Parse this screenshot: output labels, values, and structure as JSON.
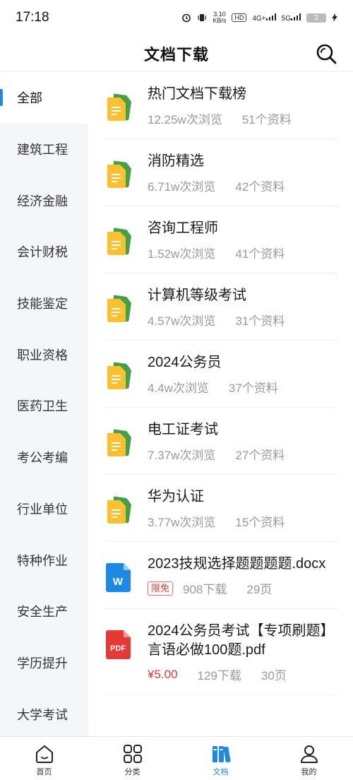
{
  "status_bar": {
    "time": "17:18",
    "net_speed_value": "3.10",
    "net_speed_unit": "KB/s",
    "hd_label": "HD",
    "signal_4g": "4G+",
    "signal_5g": "5G",
    "battery": "2"
  },
  "header": {
    "title": "文档下载"
  },
  "sidebar": {
    "items": [
      {
        "label": "全部",
        "active": true
      },
      {
        "label": "建筑工程"
      },
      {
        "label": "经济金融"
      },
      {
        "label": "会计财税"
      },
      {
        "label": "技能鉴定"
      },
      {
        "label": "职业资格"
      },
      {
        "label": "医药卫生"
      },
      {
        "label": "考公考编"
      },
      {
        "label": "行业单位"
      },
      {
        "label": "特种作业"
      },
      {
        "label": "安全生产"
      },
      {
        "label": "学历提升"
      },
      {
        "label": "大学考试"
      }
    ]
  },
  "list": {
    "items": [
      {
        "icon": "folder-doc-icon",
        "title": "热门文档下载榜",
        "views": "12.25w次浏览",
        "count": "51个资料"
      },
      {
        "icon": "folder-doc-icon",
        "title": "消防精选",
        "views": "6.71w次浏览",
        "count": "42个资料"
      },
      {
        "icon": "folder-doc-icon",
        "title": "咨询工程师",
        "views": "1.52w次浏览",
        "count": "41个资料"
      },
      {
        "icon": "folder-doc-icon",
        "title": "计算机等级考试",
        "views": "4.57w次浏览",
        "count": "31个资料"
      },
      {
        "icon": "folder-doc-icon",
        "title": "2024公务员",
        "views": "4.4w次浏览",
        "count": "37个资料"
      },
      {
        "icon": "folder-doc-icon",
        "title": "电工证考试",
        "views": "7.37w次浏览",
        "count": "27个资料"
      },
      {
        "icon": "folder-doc-icon",
        "title": "华为认证",
        "views": "3.77w次浏览",
        "count": "15个资料"
      },
      {
        "icon": "word-file-icon",
        "title": "2023技规选择题题题题.docx",
        "tag": "限免",
        "views": "908下载",
        "count": "29页"
      },
      {
        "icon": "pdf-file-icon",
        "title": "2024公务员考试【专项刷题】言语必做100题.pdf",
        "icon_text": "PDF",
        "price": "¥5.00",
        "views": "129下载",
        "count": "30页"
      }
    ],
    "word_icon_text": "W"
  },
  "bottom_nav": {
    "items": [
      {
        "label": "首页",
        "icon": "home-icon"
      },
      {
        "label": "分类",
        "icon": "grid-icon"
      },
      {
        "label": "文档",
        "icon": "documents-icon",
        "active": true
      },
      {
        "label": "我的",
        "icon": "profile-icon"
      }
    ]
  },
  "colors": {
    "accent": "#1e88e5",
    "sidebar_bg": "#f5f6f8",
    "folder_yellow": "#fbc02d",
    "folder_green": "#43a047",
    "word_blue": "#1e88e5",
    "pdf_red": "#e53935"
  }
}
